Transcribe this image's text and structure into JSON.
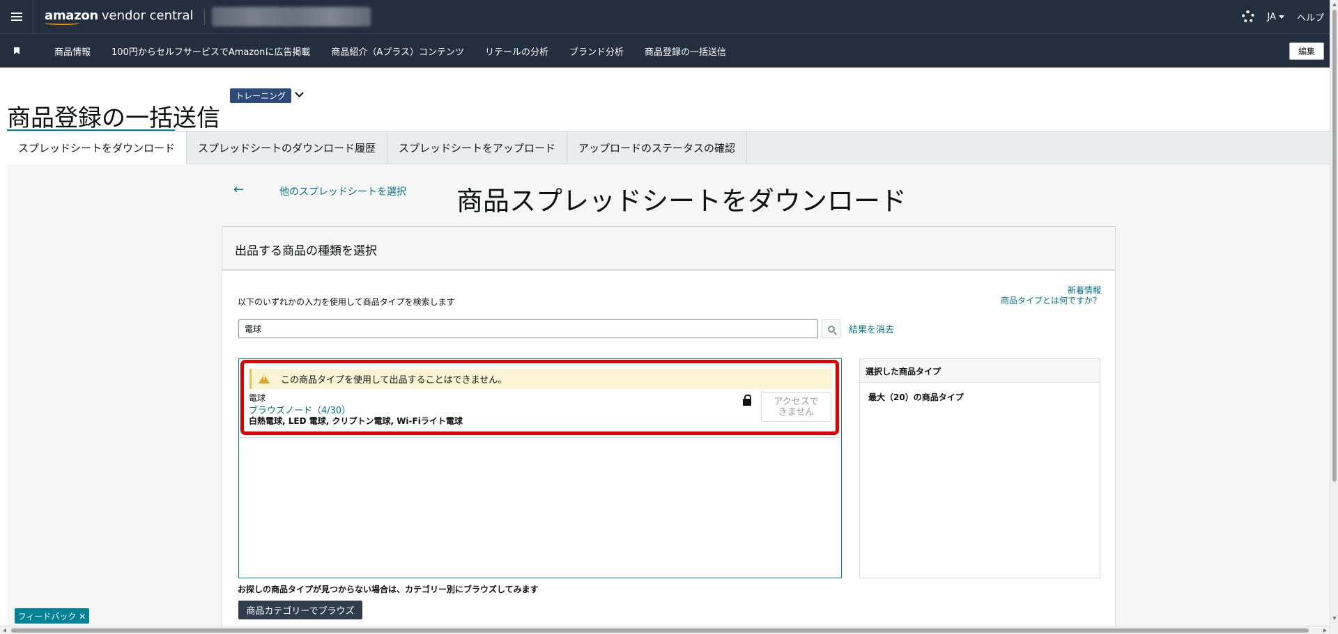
{
  "app": {
    "logo_brand": "amazon",
    "logo_product": "vendor central",
    "language": "JA",
    "help": "ヘルプ"
  },
  "nav": {
    "items": [
      "商品情報",
      "100円からセルフサービスでAmazonに広告掲載",
      "商品紹介（Aプラス）コンテンツ",
      "リテールの分析",
      "ブランド分析",
      "商品登録の一括送信"
    ],
    "edit": "編集"
  },
  "page": {
    "badge": "トレーニング",
    "title": "商品登録の一括送信"
  },
  "tabs": [
    {
      "label": "スプレッドシートをダウンロード",
      "active": true
    },
    {
      "label": "スプレッドシートのダウンロード履歴",
      "active": false
    },
    {
      "label": "スプレッドシートをアップロード",
      "active": false
    },
    {
      "label": "アップロードのステータスの確認",
      "active": false
    }
  ],
  "main": {
    "back_arrow": "←",
    "back_link": "他のスプレッドシートを選択",
    "title": "商品スプレッドシートをダウンロード",
    "panel_title": "出品する商品の種類を選択",
    "search_hint": "以下のいずれかの入力を使用して商品タイプを検索します",
    "news_link": "新着情報",
    "what_is_link": "商品タイプとは何ですか？",
    "search_value": "電球",
    "clear_link": "結果を消去"
  },
  "result": {
    "warning": "この商品タイプを使用して出品することはできません。",
    "name": "電球",
    "browse_node": "ブラウズノード（4/30）",
    "description": "白熱電球, LED 電球, クリプトン電球, Wi-Fiライト電球",
    "access_line1": "アクセスで",
    "access_line2": "きません"
  },
  "selected": {
    "header": "選択した商品タイプ",
    "max_text": "最大（20）の商品タイプ"
  },
  "footer": {
    "not_found": "お探しの商品タイプが見つからない場合は、カテゴリー別にブラウズしてみます",
    "browse_button": "商品カテゴリーでブラウズ",
    "feedback": "フィードバック ✕"
  },
  "colors": {
    "header_bg": "#232f3e",
    "accent_teal": "#008296",
    "link": "#007185",
    "warning_bg": "#fcf4d4",
    "highlight": "#e00000"
  }
}
